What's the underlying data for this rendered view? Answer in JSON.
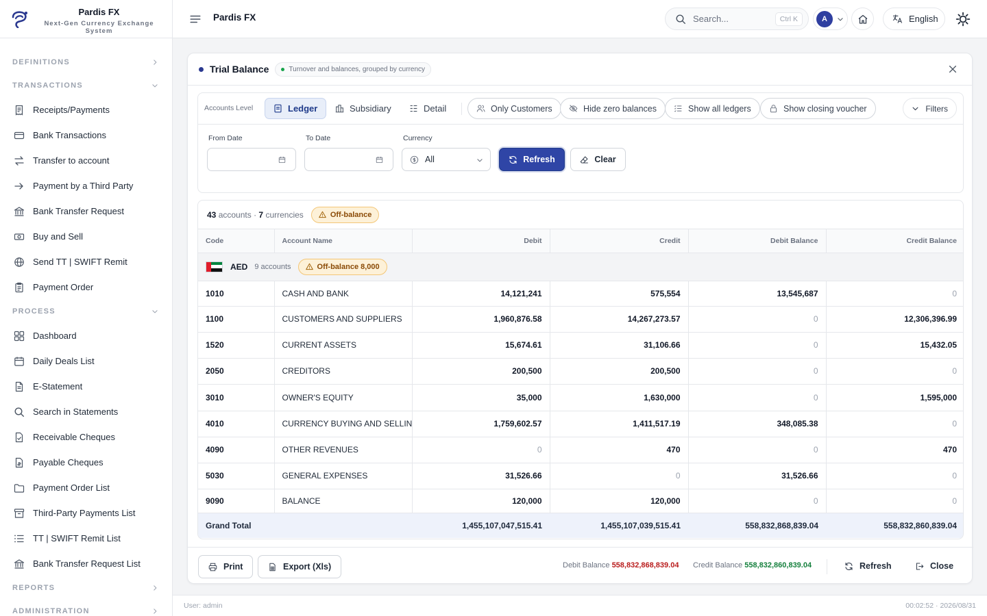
{
  "brand": {
    "name": "Pardis FX",
    "subtitle": "Next-Gen Currency Exchange System"
  },
  "sidebar": {
    "sections": {
      "definitions": "DEFINITIONS",
      "transactions": "TRANSACTIONS",
      "process": "PROCESS",
      "reports": "REPORTS",
      "administration": "ADMINISTRATION"
    },
    "transactions": [
      {
        "label": "Receipts/Payments",
        "icon": "receipt-icon"
      },
      {
        "label": "Bank Transactions",
        "icon": "card-icon"
      },
      {
        "label": "Transfer to account",
        "icon": "transfer-icon"
      },
      {
        "label": "Payment by a Third Party",
        "icon": "arrow-right-icon"
      },
      {
        "label": "Bank Transfer Request",
        "icon": "bank-icon"
      },
      {
        "label": "Buy and Sell",
        "icon": "cash-icon"
      },
      {
        "label": "Send TT | SWIFT Remit",
        "icon": "globe-icon"
      },
      {
        "label": "Payment Order",
        "icon": "clipboard-icon"
      }
    ],
    "process": [
      {
        "label": "Dashboard",
        "icon": "dashboard-icon"
      },
      {
        "label": "Daily Deals List",
        "icon": "calendar-icon"
      },
      {
        "label": "E-Statement",
        "icon": "document-icon"
      },
      {
        "label": "Search in Statements",
        "icon": "search-icon"
      },
      {
        "label": "Receivable Cheques",
        "icon": "cheque-in-icon"
      },
      {
        "label": "Payable Cheques",
        "icon": "cheque-out-icon"
      },
      {
        "label": "Payment Order List",
        "icon": "folder-icon"
      },
      {
        "label": "Third-Party Payments List",
        "icon": "archive-icon"
      },
      {
        "label": "TT | SWIFT Remit List",
        "icon": "list-icon"
      },
      {
        "label": "Bank Transfer Request List",
        "icon": "bank-icon"
      }
    ]
  },
  "topbar": {
    "title": "Pardis FX",
    "search_placeholder": "Search...",
    "search_shortcut": "Ctrl K",
    "avatar_initial": "A",
    "language": "English"
  },
  "card": {
    "title": "Trial Balance",
    "subtitle": "Turnover and balances, grouped by currency"
  },
  "filters": {
    "accounts_level_label": "Accounts Level",
    "levels": [
      "Ledger",
      "Subsidiary",
      "Detail"
    ],
    "active_level": "Ledger",
    "toggles": [
      "Only Customers",
      "Hide zero balances",
      "Show all ledgers",
      "Show closing voucher"
    ],
    "filters_label": "Filters",
    "from_date_label": "From Date",
    "to_date_label": "To Date",
    "currency_label": "Currency",
    "currency_value": "All",
    "refresh_label": "Refresh",
    "clear_label": "Clear"
  },
  "summary": {
    "accounts_count": "43",
    "accounts_word": "accounts",
    "separator": "·",
    "currencies_count": "7",
    "currencies_word": "currencies",
    "off_balance_label": "Off-balance"
  },
  "table": {
    "columns": [
      "Code",
      "Account Name",
      "Debit",
      "Credit",
      "Debit Balance",
      "Credit Balance"
    ],
    "group": {
      "currency": "AED",
      "accounts": "9 accounts",
      "off_balance": "Off-balance 8,000"
    },
    "rows": [
      {
        "code": "1010",
        "name": "CASH AND BANK",
        "debit": "14,121,241",
        "credit": "575,554",
        "debit_balance": "13,545,687",
        "credit_balance": "0"
      },
      {
        "code": "1100",
        "name": "CUSTOMERS AND SUPPLIERS",
        "debit": "1,960,876.58",
        "credit": "14,267,273.57",
        "debit_balance": "0",
        "credit_balance": "12,306,396.99"
      },
      {
        "code": "1520",
        "name": "CURRENT ASSETS",
        "debit": "15,674.61",
        "credit": "31,106.66",
        "debit_balance": "0",
        "credit_balance": "15,432.05"
      },
      {
        "code": "2050",
        "name": "CREDITORS",
        "debit": "200,500",
        "credit": "200,500",
        "debit_balance": "0",
        "credit_balance": "0"
      },
      {
        "code": "3010",
        "name": "OWNER'S EQUITY",
        "debit": "35,000",
        "credit": "1,630,000",
        "debit_balance": "0",
        "credit_balance": "1,595,000"
      },
      {
        "code": "4010",
        "name": "CURRENCY BUYING AND SELLING",
        "debit": "1,759,602.57",
        "credit": "1,411,517.19",
        "debit_balance": "348,085.38",
        "credit_balance": "0"
      },
      {
        "code": "4090",
        "name": "OTHER REVENUES",
        "debit": "0",
        "credit": "470",
        "debit_balance": "0",
        "credit_balance": "470"
      },
      {
        "code": "5030",
        "name": "GENERAL EXPENSES",
        "debit": "31,526.66",
        "credit": "0",
        "debit_balance": "31,526.66",
        "credit_balance": "0"
      },
      {
        "code": "9090",
        "name": "BALANCE",
        "debit": "120,000",
        "credit": "120,000",
        "debit_balance": "0",
        "credit_balance": "0"
      }
    ],
    "total": {
      "label": "Grand Total",
      "debit": "1,455,107,047,515.41",
      "credit": "1,455,107,039,515.41",
      "debit_balance": "558,832,868,839.04",
      "credit_balance": "558,832,860,839.04"
    }
  },
  "footer": {
    "print_label": "Print",
    "export_label": "Export (Xls)",
    "debit_balance_label": "Debit Balance",
    "debit_balance_value": "558,832,868,839.04",
    "credit_balance_label": "Credit Balance",
    "credit_balance_value": "558,832,860,839.04",
    "refresh_label": "Refresh",
    "close_label": "Close"
  },
  "statusbar": {
    "user": "User: admin",
    "time": "00:02:52 · 2026/08/31"
  },
  "colors": {
    "primary": "#2f45a6",
    "negative": "#b91c1c",
    "positive": "#15803d",
    "warning_bg": "#fdf1d8"
  }
}
